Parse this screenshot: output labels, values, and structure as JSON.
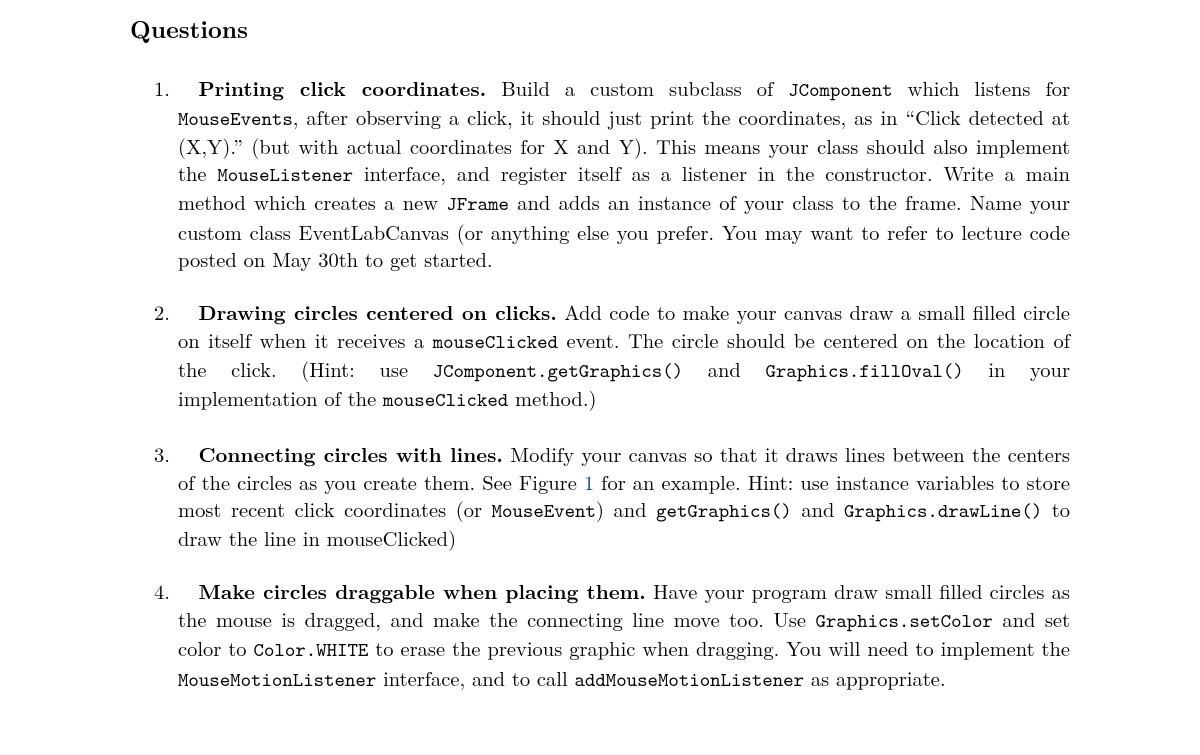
{
  "heading": "Questions",
  "items": [
    {
      "title": "Printing click coordinates.",
      "segments": [
        {
          "t": "text",
          "v": " Build a custom subclass of "
        },
        {
          "t": "code",
          "v": "JComponent"
        },
        {
          "t": "text",
          "v": " which listens for "
        },
        {
          "t": "code",
          "v": "MouseEvents"
        },
        {
          "t": "text",
          "v": ", after observing a click, it should just print the coordinates, as in “Click detected at (X,Y).” (but with actual coordinates for X and Y). This means your class should also implement the "
        },
        {
          "t": "code",
          "v": "MouseListener"
        },
        {
          "t": "text",
          "v": " interface, and register itself as a listener in the constructor. Write a main method which creates a new "
        },
        {
          "t": "code",
          "v": "JFrame"
        },
        {
          "t": "text",
          "v": " and adds an instance of your class to the frame. Name your custom class EventLabCanvas (or anything else you prefer. You may want to refer to lecture code posted on May 30th to get started."
        }
      ]
    },
    {
      "title": "Drawing circles centered on clicks.",
      "segments": [
        {
          "t": "text",
          "v": " Add code to make your canvas draw a small filled circle on itself when it receives a "
        },
        {
          "t": "code",
          "v": "mouseClicked"
        },
        {
          "t": "text",
          "v": " event. The circle should be centered on the location of the click. (Hint: use "
        },
        {
          "t": "code",
          "v": "JComponent.getGraphics()"
        },
        {
          "t": "text",
          "v": " and "
        },
        {
          "t": "code",
          "v": "Graphics.fillOval()"
        },
        {
          "t": "text",
          "v": " in your implementation of the "
        },
        {
          "t": "code",
          "v": "mouseClicked"
        },
        {
          "t": "text",
          "v": " method.)"
        }
      ]
    },
    {
      "title": "Connecting circles with lines.",
      "segments": [
        {
          "t": "text",
          "v": " Modify your canvas so that it draws lines between the centers of the circles as you create them. See Figure "
        },
        {
          "t": "figref",
          "v": "1"
        },
        {
          "t": "text",
          "v": " for an example. Hint: use instance variables to store most recent click coordinates (or "
        },
        {
          "t": "code",
          "v": "MouseEvent"
        },
        {
          "t": "text",
          "v": ") and "
        },
        {
          "t": "code",
          "v": "getGraphics()"
        },
        {
          "t": "text",
          "v": " and "
        },
        {
          "t": "code",
          "v": "Graphics.drawLine()"
        },
        {
          "t": "text",
          "v": " to draw the line in mouseClicked)"
        }
      ]
    },
    {
      "title": "Make circles draggable when placing them.",
      "segments": [
        {
          "t": "text",
          "v": " Have your program draw small filled circles as the mouse is dragged, and make the connecting line move too. Use "
        },
        {
          "t": "code",
          "v": "Graphics.setColor"
        },
        {
          "t": "text",
          "v": " and set color to "
        },
        {
          "t": "code",
          "v": "Color.WHITE"
        },
        {
          "t": "text",
          "v": " to erase the previous graphic when dragging. You will need to implement the "
        },
        {
          "t": "code",
          "v": "MouseMotionListener"
        },
        {
          "t": "text",
          "v": " interface, and to call "
        },
        {
          "t": "code",
          "v": "addMouseMotionListener"
        },
        {
          "t": "text",
          "v": " as appropriate."
        }
      ]
    }
  ]
}
